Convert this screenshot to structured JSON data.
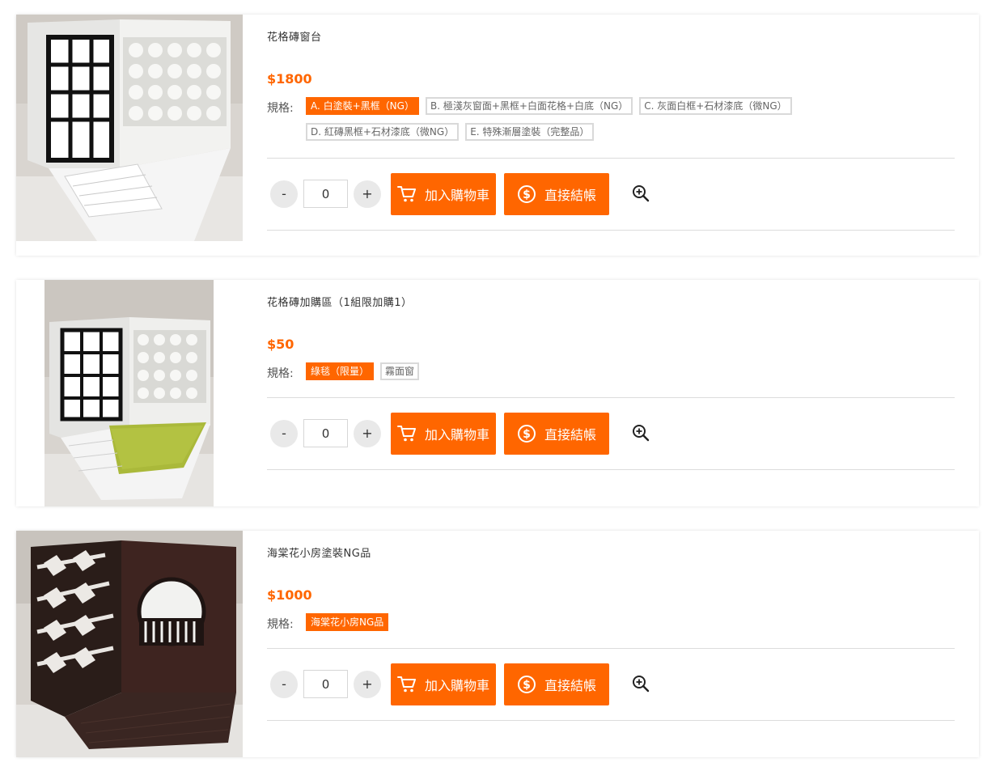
{
  "products": [
    {
      "name": "花格磚窗台",
      "price": "$1800",
      "spec_label": "規格:",
      "options": [
        {
          "label": "A. 白塗裝+黑框（NG）",
          "selected": true
        },
        {
          "label": "B. 極淺灰窗面+黑框+白面花格+白底（NG）",
          "selected": false
        },
        {
          "label": "C. 灰面白框+石材漆底（微NG）",
          "selected": false
        },
        {
          "label": "D. 紅磚黑框+石材漆底（微NG）",
          "selected": false
        },
        {
          "label": "E. 特殊漸層塗裝（完整品）",
          "selected": false
        }
      ],
      "quantity": "0",
      "minus": "-",
      "plus": "+",
      "add_to_cart": "加入購物車",
      "checkout": "直接結帳"
    },
    {
      "name": "花格磚加購區（1組限加購1）",
      "price": "$50",
      "spec_label": "規格:",
      "options": [
        {
          "label": "綠毯（限量）",
          "selected": true
        },
        {
          "label": "霧面窗",
          "selected": false
        }
      ],
      "quantity": "0",
      "minus": "-",
      "plus": "+",
      "add_to_cart": "加入購物車",
      "checkout": "直接結帳"
    },
    {
      "name": "海棠花小房塗裝NG品",
      "price": "$1000",
      "spec_label": "規格:",
      "options": [
        {
          "label": "海棠花小房NG品",
          "selected": true
        }
      ],
      "quantity": "0",
      "minus": "-",
      "plus": "+",
      "add_to_cart": "加入購物車",
      "checkout": "直接結帳"
    }
  ],
  "icons": {
    "cart": "cart-icon",
    "checkout": "dollar-circle-icon",
    "zoom": "zoom-in-icon"
  },
  "colors": {
    "accent": "#ff6600",
    "option_border": "#d9d9d9",
    "qty_button_bg": "#e9e9e9"
  }
}
